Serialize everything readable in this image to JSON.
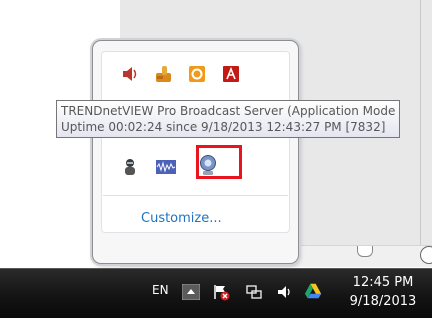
{
  "tooltip": {
    "line1": "TRENDnetVIEW Pro Broadcast Server (Application Mode",
    "line2": "Uptime 00:02:24 since 9/18/2013 12:43:27 PM [7832]"
  },
  "tray_popup": {
    "customize_label": "Customize...",
    "icons": [
      "speaker-icon",
      "hand-update-icon",
      "office-icon",
      "adobe-icon",
      "security-agent-icon",
      "audio-waveform-icon",
      "trendnetview-server-icon"
    ]
  },
  "taskbar": {
    "language": "EN",
    "time": "12:45 PM",
    "date": "9/18/2013",
    "icons": [
      "show-hidden-icons-arrow",
      "action-center-flag-icon",
      "network-icon",
      "volume-icon",
      "google-drive-icon"
    ]
  },
  "colors": {
    "highlight": "#e8141e",
    "link": "#1f73c1",
    "taskbar": "#141414"
  }
}
